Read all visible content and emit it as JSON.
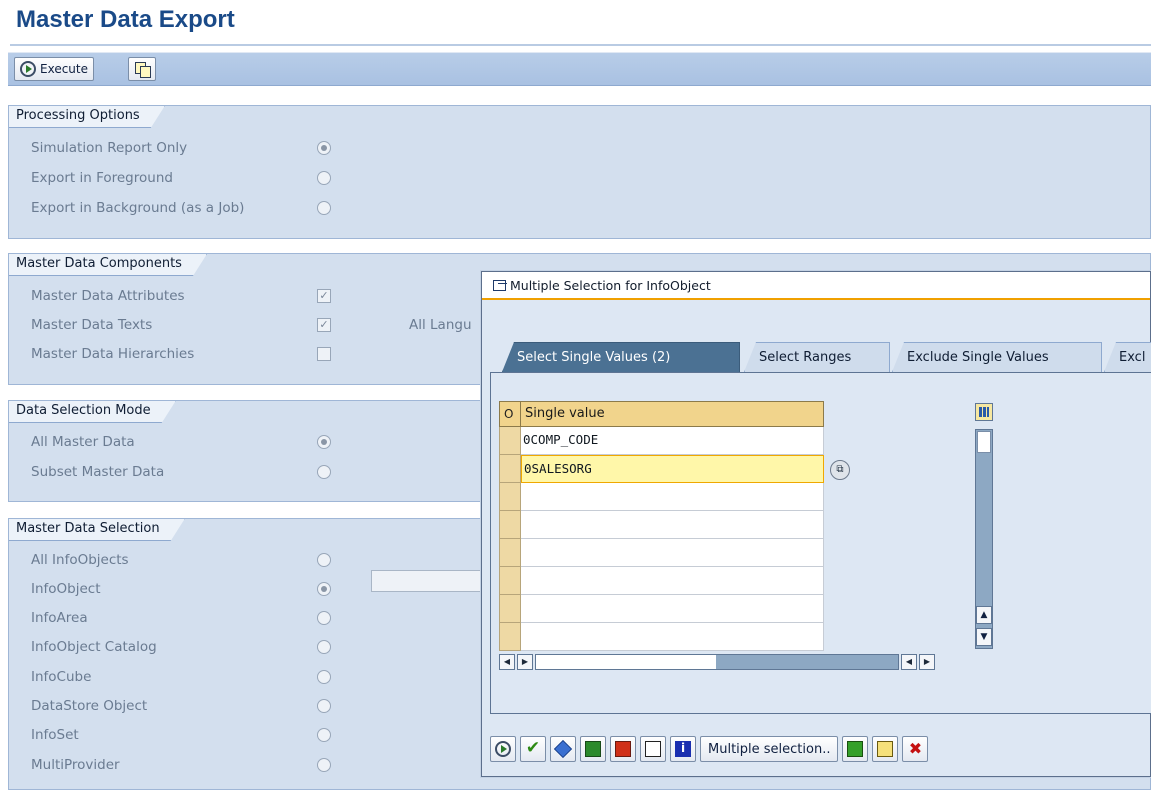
{
  "page": {
    "title": "Master Data Export"
  },
  "toolbar": {
    "execute_label": "Execute"
  },
  "processing_options": {
    "header": "Processing Options",
    "options": [
      {
        "label": "Simulation Report Only",
        "selected": true
      },
      {
        "label": "Export in Foreground",
        "selected": false
      },
      {
        "label": "Export in Background (as a Job)",
        "selected": false
      }
    ]
  },
  "components": {
    "header": "Master Data Components",
    "items": [
      {
        "label": "Master Data Attributes",
        "checked": true
      },
      {
        "label": "Master Data Texts",
        "checked": true
      },
      {
        "label": "Master Data Hierarchies",
        "checked": false
      }
    ],
    "side_label": "All Langu"
  },
  "selection_mode": {
    "header": "Data Selection Mode",
    "options": [
      {
        "label": "All Master Data",
        "selected": true
      },
      {
        "label": "Subset Master Data",
        "selected": false
      }
    ]
  },
  "master_selection": {
    "header": "Master Data Selection",
    "options": [
      {
        "label": "All InfoObjects",
        "selected": false
      },
      {
        "label": "InfoObject",
        "selected": true
      },
      {
        "label": "InfoArea",
        "selected": false
      },
      {
        "label": "InfoObject Catalog",
        "selected": false
      },
      {
        "label": "InfoCube",
        "selected": false
      },
      {
        "label": "DataStore Object",
        "selected": false
      },
      {
        "label": "InfoSet",
        "selected": false
      },
      {
        "label": "MultiProvider",
        "selected": false
      }
    ]
  },
  "dialog": {
    "title": "Multiple Selection for InfoObject",
    "tabs": [
      {
        "label": "Select Single Values (2)",
        "active": true
      },
      {
        "label": "Select Ranges",
        "active": false
      },
      {
        "label": "Exclude Single Values",
        "active": false
      },
      {
        "label": "Excl",
        "active": false
      }
    ],
    "grid": {
      "sel_header": "O",
      "col_header": "Single value",
      "rows": [
        "0COMP_CODE",
        "0SALESORG",
        "",
        "",
        "",
        "",
        "",
        ""
      ],
      "highlighted_row": 1
    },
    "footer": {
      "multiple_selection_label": "Multiple selection.."
    },
    "icons": {
      "execute": "execute-icon",
      "confirm": "checkmark-icon",
      "maintain": "diamond-icon",
      "insert": "insert-line-icon",
      "delete_line": "delete-line-icon",
      "trash": "trash-icon",
      "info": "info-icon",
      "import": "import-icon",
      "paste": "paste-icon",
      "cancel": "cancel-icon"
    }
  },
  "colors": {
    "title": "#1a4a88",
    "toolbar": "#afc6e5",
    "group_bg": "#d3dfee",
    "tab_active": "#4b7193",
    "grid_header": "#f1d48c",
    "highlight": "#fff7a9"
  }
}
